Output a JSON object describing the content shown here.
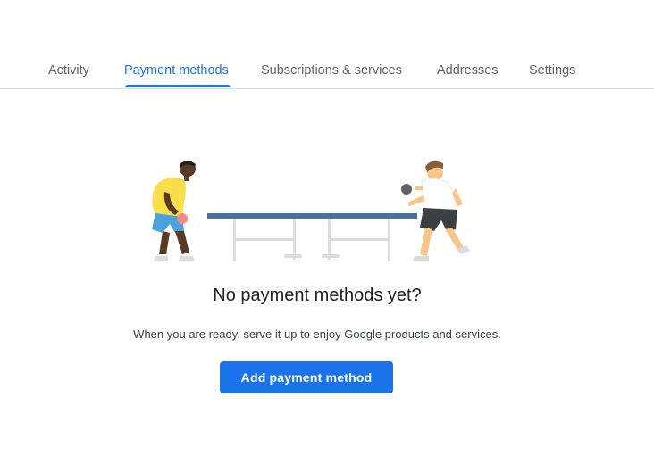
{
  "tabs": [
    {
      "label": "Activity",
      "active": false
    },
    {
      "label": "Payment methods",
      "active": true
    },
    {
      "label": "Subscriptions & services",
      "active": false
    },
    {
      "label": "Addresses",
      "active": false
    },
    {
      "label": "Settings",
      "active": false
    }
  ],
  "empty_state": {
    "illustration": "ping-pong-players-illustration",
    "title": "No payment methods yet?",
    "subtitle": "When you are ready, serve it up to enjoy Google products and services.",
    "button_label": "Add payment method"
  },
  "colors": {
    "accent": "#1a73e8",
    "tab_inactive": "#5f6368",
    "divider": "#dadce0",
    "table_top": "#4a6fa5"
  }
}
